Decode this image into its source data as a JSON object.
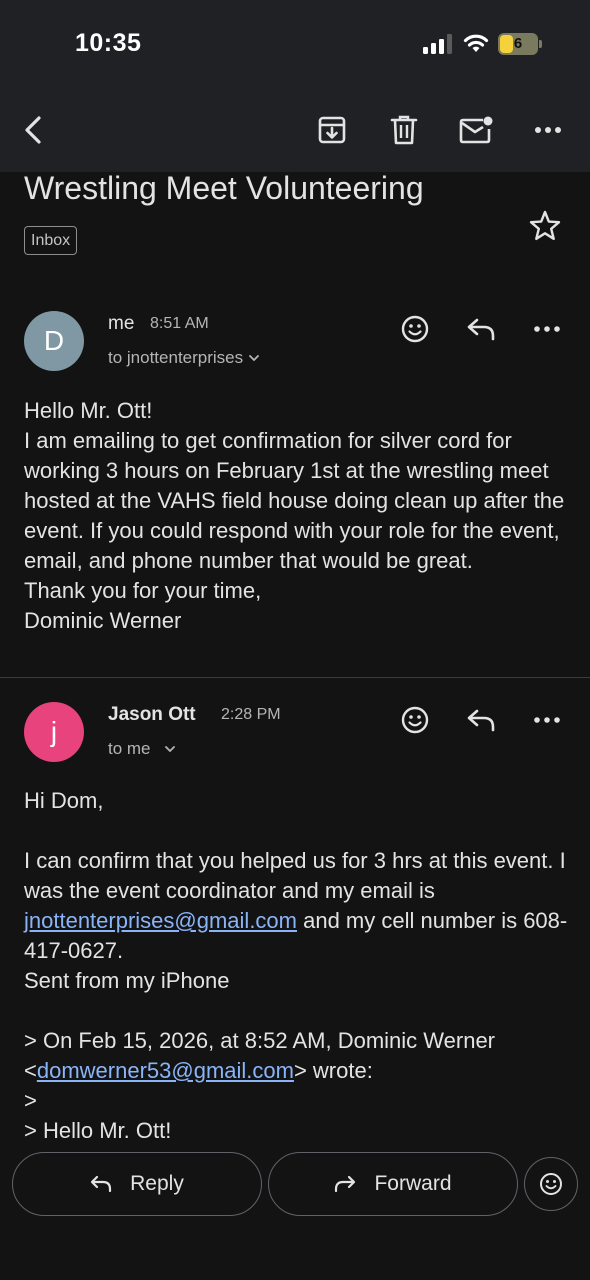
{
  "status_bar": {
    "time": "10:35",
    "battery": "6"
  },
  "toolbar": {
    "back": "back-arrow-icon",
    "archive": "archive-icon",
    "delete": "trash-icon",
    "mark_unread": "mark-unread-icon",
    "more": "more-icon"
  },
  "email": {
    "subject": "Wrestling Meet Volunteering",
    "label": "Inbox"
  },
  "messages": [
    {
      "avatar_letter": "D",
      "avatar_color": "#7f98a3",
      "sender": "me",
      "time": "8:51 AM",
      "recipient": "to jnottenterprises",
      "body": [
        "Hello Mr. Ott!",
        "I am emailing to get confirmation for silver cord for working 3 hours on February 1st at the wrestling meet hosted at the VAHS field house doing clean up after the event. If you could respond with your role for the event, email, and phone number that would be great.",
        "Thank you for your time,",
        "Dominic Werner"
      ]
    },
    {
      "avatar_letter": "j",
      "avatar_color": "#e8437c",
      "sender": "Jason Ott",
      "time": "2:28 PM",
      "recipient": "to me",
      "body": {
        "greeting": "Hi Dom,",
        "para_before_link": "I can confirm that you helped us for 3 hrs at this event.  I was the event coordinator and my email is ",
        "email_link": "jnottenterprises@gmail.com",
        "para_after_link": " and my cell number is 608-417-0627.",
        "signature": "Sent from my iPhone",
        "quote_line1": "> On Feb 15, 2026, at 8:52 AM, Dominic Werner",
        "quote_lt": "<",
        "quote_email": "domwerner53@gmail.com",
        "quote_wrote": "> wrote:",
        "quote_line3": ">",
        "quote_line4": "> Hello Mr. Ott!"
      }
    }
  ],
  "actions": {
    "reply": "Reply",
    "forward": "Forward"
  },
  "colors": {
    "background": "#131314",
    "toolbar": "#202124",
    "link": "#8ab4f8"
  }
}
